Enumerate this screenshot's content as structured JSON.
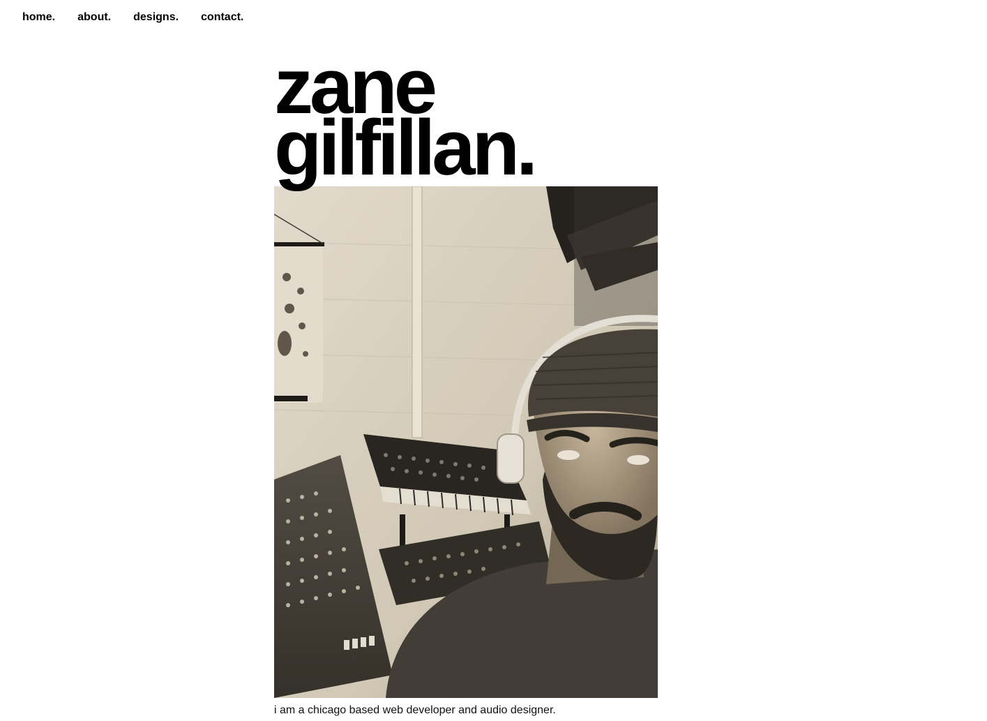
{
  "nav": {
    "items": [
      {
        "label": "home."
      },
      {
        "label": "about."
      },
      {
        "label": "designs."
      },
      {
        "label": "contact."
      }
    ]
  },
  "hero": {
    "title_line1": "zane",
    "title_line2": "gilfillan.",
    "bio": "i am a chicago based web developer and audio designer."
  },
  "colors": {
    "text": "#000000",
    "background": "#ffffff",
    "photo_tone": "#d9d3c4"
  }
}
